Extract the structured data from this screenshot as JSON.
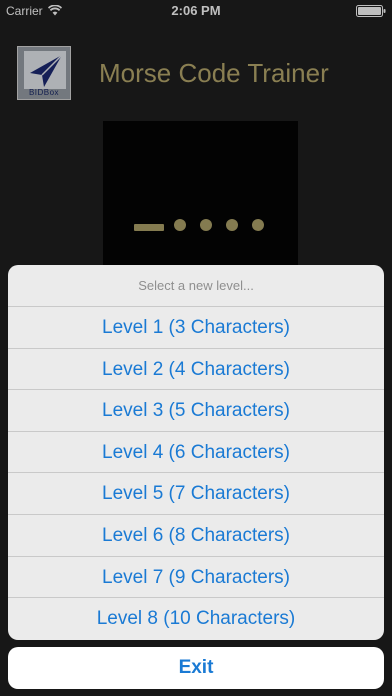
{
  "status_bar": {
    "carrier": "Carrier",
    "time": "2:06 PM"
  },
  "header": {
    "logo_text": "BIDBox",
    "title": "Morse Code Trainer"
  },
  "morse_display": {
    "symbols": [
      "dash",
      "dot",
      "dot",
      "dot",
      "dot"
    ],
    "color": "#b0a56b"
  },
  "action_sheet": {
    "title": "Select a new level...",
    "options": [
      "Level 1 (3 Characters)",
      "Level 2 (4 Characters)",
      "Level 3 (5 Characters)",
      "Level 4 (6 Characters)",
      "Level 5 (7 Characters)",
      "Level 6 (8 Characters)",
      "Level 7 (9 Characters)",
      "Level 8 (10 Characters)"
    ],
    "cancel_label": "Exit",
    "accent_color": "#1a7ad4"
  }
}
